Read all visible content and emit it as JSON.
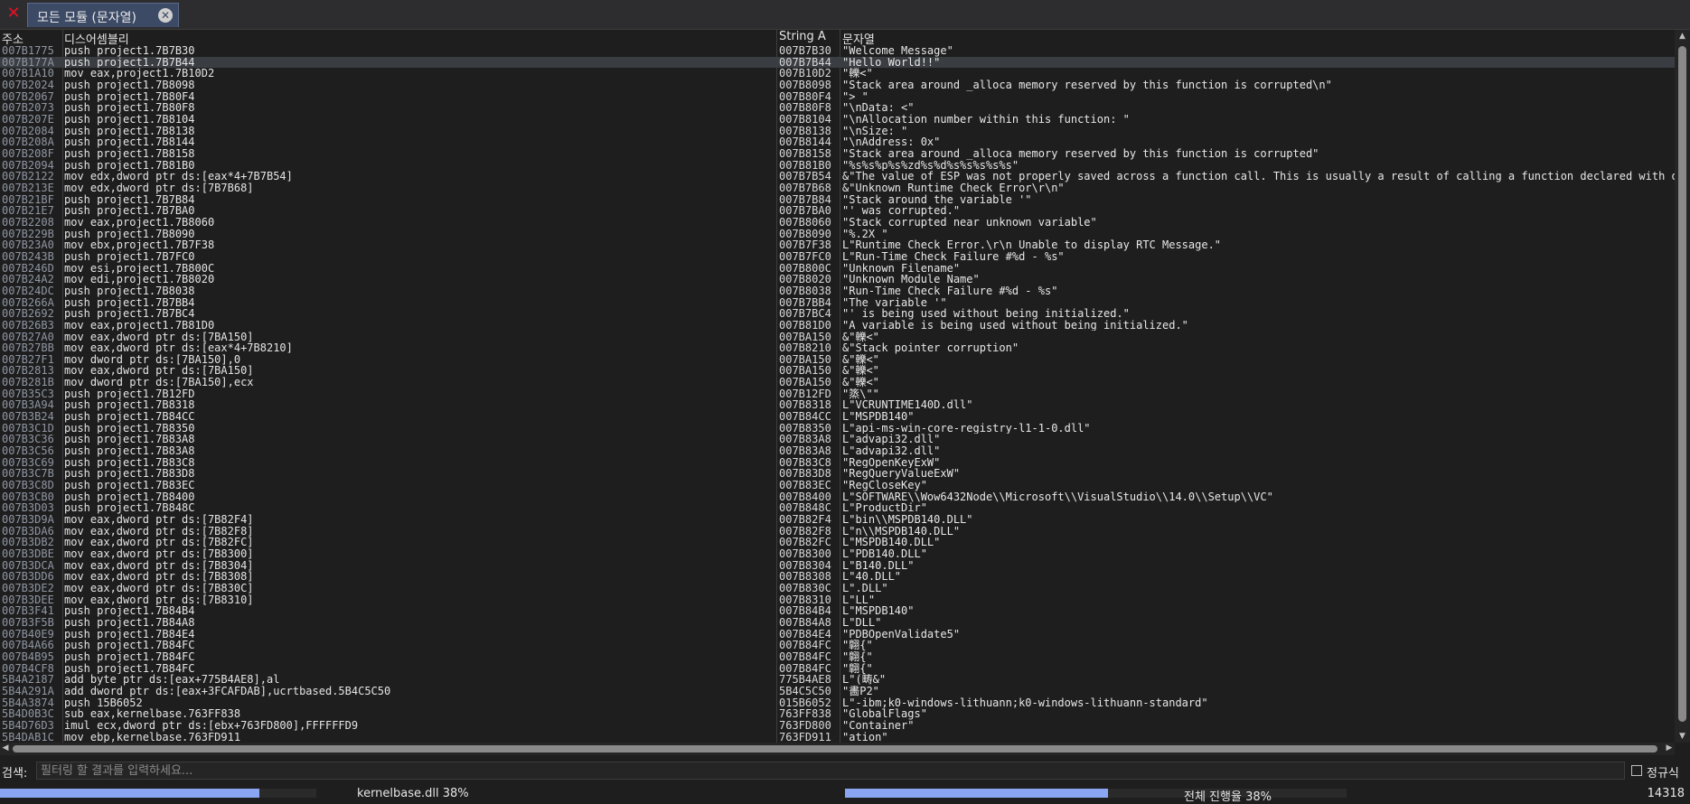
{
  "tab": {
    "label": "모든 모듈 (문자열)"
  },
  "columns": {
    "address": "주소",
    "disassembly": "디스어셈블리",
    "string_address": "String A",
    "string": "문자열"
  },
  "rows": [
    [
      "007B1775",
      "push project1.7B7B30",
      "007B7B30",
      "\"Welcome Message\""
    ],
    [
      "007B177A",
      "push project1.7B7B44",
      "007B7B44",
      "\"Hello World!!\""
    ],
    [
      "007B1A10",
      "mov eax,project1.7B10D2",
      "007B10D2",
      "\"轢<\""
    ],
    [
      "007B2024",
      "push project1.7B8098",
      "007B8098",
      "\"Stack area around _alloca memory reserved by this function is corrupted\\n\""
    ],
    [
      "007B2067",
      "push project1.7B80F4",
      "007B80F4",
      "\"> \""
    ],
    [
      "007B2073",
      "push project1.7B80F8",
      "007B80F8",
      "\"\\nData: <\""
    ],
    [
      "007B207E",
      "push project1.7B8104",
      "007B8104",
      "\"\\nAllocation number within this function: \""
    ],
    [
      "007B2084",
      "push project1.7B8138",
      "007B8138",
      "\"\\nSize: \""
    ],
    [
      "007B208A",
      "push project1.7B8144",
      "007B8144",
      "\"\\nAddress: 0x\""
    ],
    [
      "007B208F",
      "push project1.7B8158",
      "007B8158",
      "\"Stack area around _alloca memory reserved by this function is corrupted\""
    ],
    [
      "007B2094",
      "push project1.7B81B0",
      "007B81B0",
      "\"%s%s%p%s%zd%s%d%s%s%s%s%s\""
    ],
    [
      "007B2122",
      "mov edx,dword ptr ds:[eax*4+7B7B54]",
      "007B7B54",
      "&\"The value of ESP was not properly saved across a function call.  This is usually a result of calling a function declared with one calling convention\""
    ],
    [
      "007B213E",
      "mov edx,dword ptr ds:[7B7B68]",
      "007B7B68",
      "&\"Unknown Runtime Check Error\\r\\n\""
    ],
    [
      "007B21BF",
      "push project1.7B7B84",
      "007B7B84",
      "\"Stack around the variable '\""
    ],
    [
      "007B21E7",
      "push project1.7B7BA0",
      "007B7BA0",
      "\"' was corrupted.\""
    ],
    [
      "007B2208",
      "mov eax,project1.7B8060",
      "007B8060",
      "\"Stack corrupted near unknown variable\""
    ],
    [
      "007B229B",
      "push project1.7B8090",
      "007B8090",
      "\"%.2X \""
    ],
    [
      "007B23A0",
      "mov ebx,project1.7B7F38",
      "007B7F38",
      "L\"Runtime Check Error.\\r\\n Unable to display RTC Message.\""
    ],
    [
      "007B243B",
      "push project1.7B7FC0",
      "007B7FC0",
      "L\"Run-Time Check Failure #%d - %s\""
    ],
    [
      "007B246D",
      "mov esi,project1.7B800C",
      "007B800C",
      "\"Unknown Filename\""
    ],
    [
      "007B24A2",
      "mov edi,project1.7B8020",
      "007B8020",
      "\"Unknown Module Name\""
    ],
    [
      "007B24DC",
      "push project1.7B8038",
      "007B8038",
      "\"Run-Time Check Failure #%d - %s\""
    ],
    [
      "007B266A",
      "push project1.7B7BB4",
      "007B7BB4",
      "\"The variable '\""
    ],
    [
      "007B2692",
      "push project1.7B7BC4",
      "007B7BC4",
      "\"' is being used without being initialized.\""
    ],
    [
      "007B26B3",
      "mov eax,project1.7B81D0",
      "007B81D0",
      "\"A variable is being used without being initialized.\""
    ],
    [
      "007B27A0",
      "mov eax,dword ptr ds:[7BA150]",
      "007BA150",
      "&\"轢<\""
    ],
    [
      "007B27BB",
      "mov eax,dword ptr ds:[eax*4+7B8210]",
      "007B8210",
      "&\"Stack pointer corruption\""
    ],
    [
      "007B27F1",
      "mov dword ptr ds:[7BA150],0",
      "007BA150",
      "&\"轢<\""
    ],
    [
      "007B2813",
      "mov eax,dword ptr ds:[7BA150]",
      "007BA150",
      "&\"轢<\""
    ],
    [
      "007B281B",
      "mov dword ptr ds:[7BA150],ecx",
      "007BA150",
      "&\"轢<\""
    ],
    [
      "007B35C3",
      "push project1.7B12FD",
      "007B12FD",
      "\"篜\\\"\""
    ],
    [
      "007B3A94",
      "push project1.7B8318",
      "007B8318",
      "L\"VCRUNTIME140D.dll\""
    ],
    [
      "007B3B24",
      "push project1.7B84CC",
      "007B84CC",
      "L\"MSPDB140\""
    ],
    [
      "007B3C1D",
      "push project1.7B8350",
      "007B8350",
      "L\"api-ms-win-core-registry-l1-1-0.dll\""
    ],
    [
      "007B3C36",
      "push project1.7B83A8",
      "007B83A8",
      "L\"advapi32.dll\""
    ],
    [
      "007B3C56",
      "push project1.7B83A8",
      "007B83A8",
      "L\"advapi32.dll\""
    ],
    [
      "007B3C69",
      "push project1.7B83C8",
      "007B83C8",
      "\"RegOpenKeyExW\""
    ],
    [
      "007B3C7B",
      "push project1.7B83D8",
      "007B83D8",
      "\"RegQueryValueExW\""
    ],
    [
      "007B3C8D",
      "push project1.7B83EC",
      "007B83EC",
      "\"RegCloseKey\""
    ],
    [
      "007B3CB0",
      "push project1.7B8400",
      "007B8400",
      "L\"SOFTWARE\\\\Wow6432Node\\\\Microsoft\\\\VisualStudio\\\\14.0\\\\Setup\\\\VC\""
    ],
    [
      "007B3D03",
      "push project1.7B848C",
      "007B848C",
      "L\"ProductDir\""
    ],
    [
      "007B3D9A",
      "mov eax,dword ptr ds:[7B82F4]",
      "007B82F4",
      "L\"bin\\\\MSPDB140.DLL\""
    ],
    [
      "007B3DA6",
      "mov eax,dword ptr ds:[7B82F8]",
      "007B82F8",
      "L\"n\\\\MSPDB140.DLL\""
    ],
    [
      "007B3DB2",
      "mov eax,dword ptr ds:[7B82FC]",
      "007B82FC",
      "L\"MSPDB140.DLL\""
    ],
    [
      "007B3DBE",
      "mov eax,dword ptr ds:[7B8300]",
      "007B8300",
      "L\"PDB140.DLL\""
    ],
    [
      "007B3DCA",
      "mov eax,dword ptr ds:[7B8304]",
      "007B8304",
      "L\"B140.DLL\""
    ],
    [
      "007B3DD6",
      "mov eax,dword ptr ds:[7B8308]",
      "007B8308",
      "L\"40.DLL\""
    ],
    [
      "007B3DE2",
      "mov eax,dword ptr ds:[7B830C]",
      "007B830C",
      "L\".DLL\""
    ],
    [
      "007B3DEE",
      "mov eax,dword ptr ds:[7B8310]",
      "007B8310",
      "L\"LL\""
    ],
    [
      "007B3F41",
      "push project1.7B84B4",
      "007B84B4",
      "L\"MSPDB140\""
    ],
    [
      "007B3F5B",
      "push project1.7B84A8",
      "007B84A8",
      "L\"DLL\""
    ],
    [
      "007B40E9",
      "push project1.7B84E4",
      "007B84E4",
      "\"PDBOpenValidate5\""
    ],
    [
      "007B4A66",
      "push project1.7B84FC",
      "007B84FC",
      "\"翺{\""
    ],
    [
      "007B4B95",
      "push project1.7B84FC",
      "007B84FC",
      "\"翺{\""
    ],
    [
      "007B4CF8",
      "push project1.7B84FC",
      "007B84FC",
      "\"翺{\""
    ],
    [
      "5B4A2187",
      "add byte ptr ds:[eax+775B4AE8],al",
      "775B4AE8",
      "L\"(畴&\""
    ],
    [
      "5B4A291A",
      "add dword ptr ds:[eax+3FCAFDAB],ucrtbased.5B4C5C50",
      "5B4C5C50",
      "\"畵P2\""
    ],
    [
      "5B4A3874",
      "push 15B6052",
      "015B6052",
      "L\"-ibm;k0-windows-lithuann;k0-windows-lithuann-standard\""
    ],
    [
      "5B4D0B3C",
      "sub eax,kernelbase.763FF838",
      "763FF838",
      "\"GlobalFlags\""
    ],
    [
      "5B4D76D3",
      "imul ecx,dword ptr ds:[ebx+763FD800],FFFFFFD9",
      "763FD800",
      "\"Container\""
    ],
    [
      "5B4DAB1C",
      "mov ebp,kernelbase.763FD911",
      "763FD911",
      "\"ation\""
    ]
  ],
  "selected_row": 1,
  "search": {
    "label": "검색:",
    "placeholder": "필터링 할 결과를 입력하세요...",
    "value": ""
  },
  "regex": {
    "label": "정규식",
    "checked": false
  },
  "status": {
    "module_progress_label": "kernelbase.dll 38%",
    "module_progress": 0.38,
    "total_progress_label": "전체 진행율 38%",
    "total_progress": 0.38,
    "count": "14318"
  },
  "colors": {
    "accent": "#8aa6f2",
    "close": "#e81123",
    "background": "#1e1e1e"
  },
  "icons": {
    "close_window": "close-x-icon",
    "close_tab": "circle-close-icon"
  }
}
